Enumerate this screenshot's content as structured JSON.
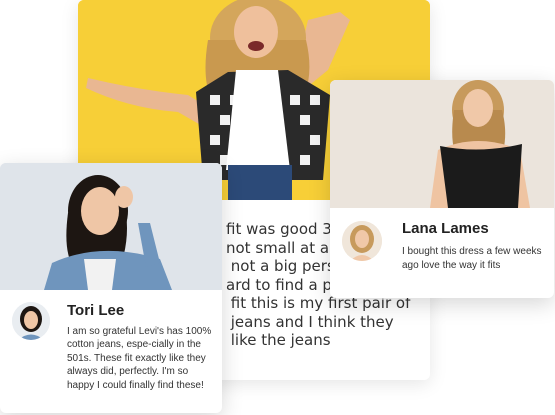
{
  "cards": {
    "back": {
      "review_text": "fit was good 34\nnot small at all\n not a big pers\nard to find a pa\n fit this is my first pair of\n jeans and I think they\n like the jeans"
    },
    "right": {
      "name": "Lana Lames",
      "review": "I bought this dress a few weeks ago love the way it fits"
    },
    "left": {
      "name": "Tori Lee",
      "review": "I am so grateful Levi's has 100% cotton jeans, espe-cially in the 501s. These fit exactly like they always did, perfectly. I'm so happy I could finally find these!"
    }
  },
  "colors": {
    "back_photo_bg": "#f7cf37",
    "right_photo_bg": "#ebe4dc",
    "left_photo_bg": "#dfe4ea"
  }
}
